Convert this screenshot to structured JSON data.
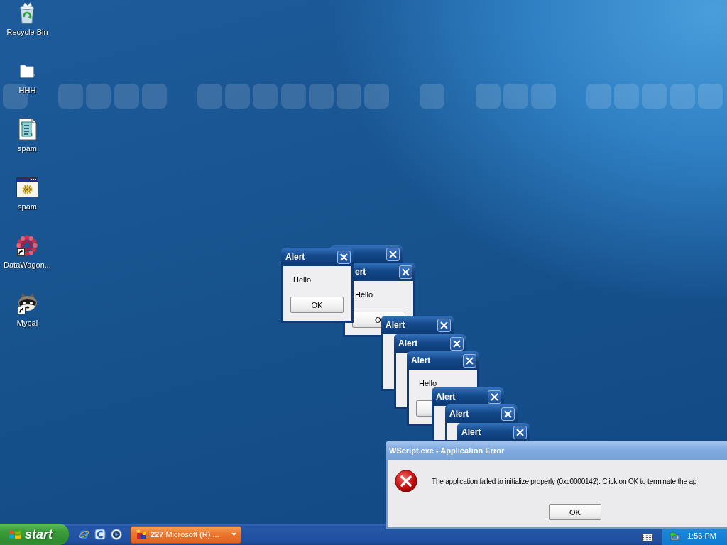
{
  "desktop_icons": [
    {
      "label": "Recycle Bin",
      "shortcut": false
    },
    {
      "label": "HHH",
      "shortcut": false
    },
    {
      "label": "spam",
      "shortcut": false
    },
    {
      "label": "spam",
      "shortcut": false
    },
    {
      "label": "DataWagon...",
      "shortcut": true
    },
    {
      "label": "Mypal",
      "shortcut": true
    }
  ],
  "windows": [
    {
      "kind": "alert",
      "button_shown": false
    },
    {
      "kind": "alert",
      "title": "ert",
      "message": "Hello",
      "button_shown": true,
      "button": "O"
    },
    {
      "kind": "alert",
      "title": "Alert",
      "message": "Hello",
      "button_shown": true,
      "button": "OK"
    },
    {
      "kind": "alert",
      "title": "Alert",
      "button_shown": false
    },
    {
      "kind": "alert",
      "title": "Alert",
      "button_shown": false
    },
    {
      "kind": "alert",
      "title": "Alert",
      "message": "Hello",
      "button_shown": true
    },
    {
      "kind": "alert",
      "title": "Alert",
      "button_shown": false
    },
    {
      "kind": "alert",
      "title": "Alert",
      "button_shown": false
    },
    {
      "kind": "alert",
      "title": "Alert",
      "button_shown": false
    },
    {
      "kind": "error",
      "title": "WScript.exe - Application Error",
      "message": "The application failed to initialize properly (0xc0000142). Click on OK to terminate the ap",
      "button": "OK"
    }
  ],
  "taskbar": {
    "start_label": "start",
    "task_button": {
      "label": "**227** Microsoft (R) ...",
      "flashing": true
    },
    "clock": "1:56 PM"
  }
}
